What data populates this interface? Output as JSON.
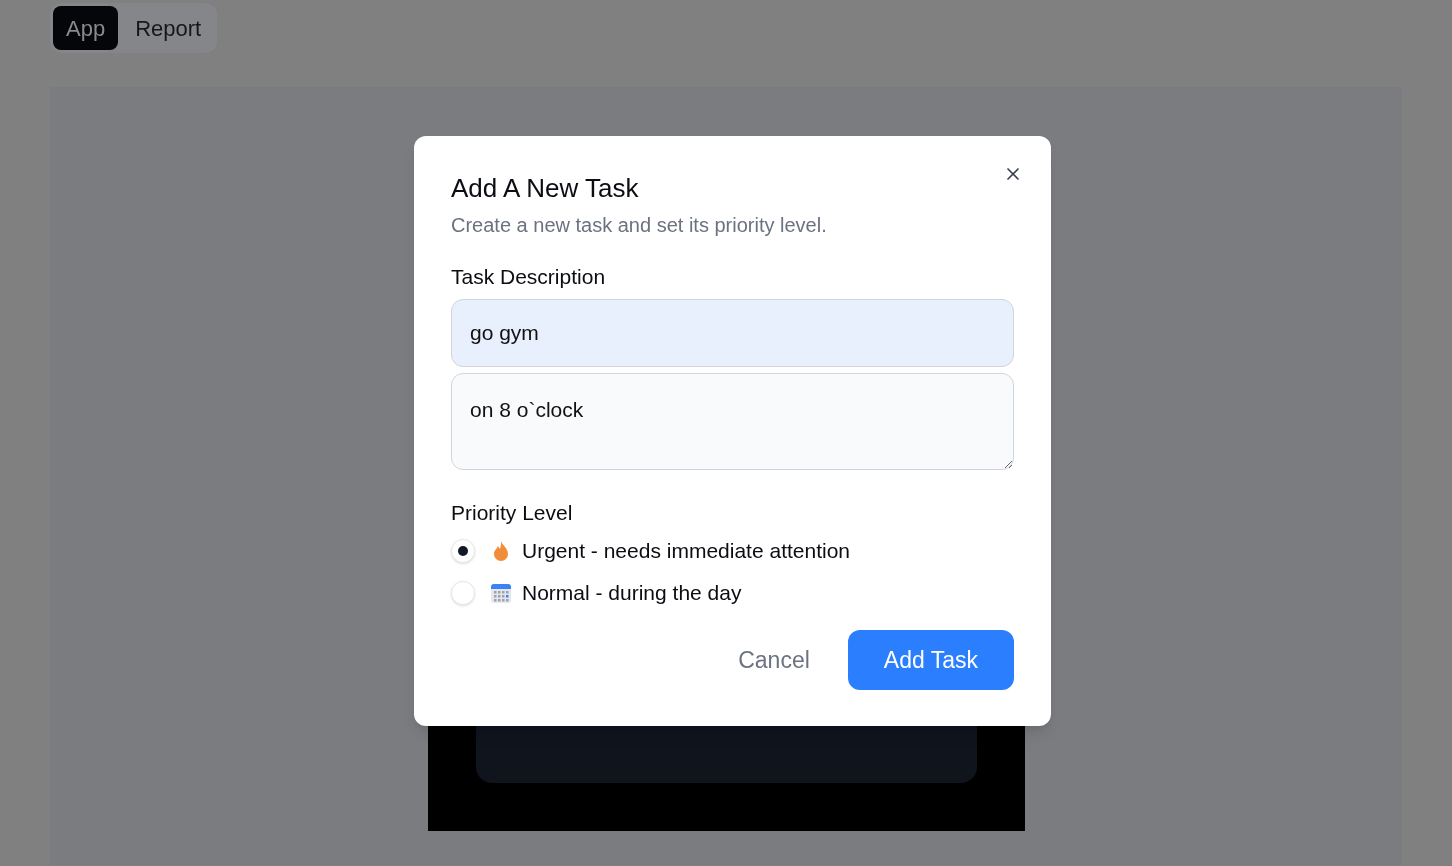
{
  "nav_tabs": [
    {
      "label": "App",
      "selected": true
    },
    {
      "label": "Report",
      "selected": false
    }
  ],
  "dialog": {
    "title": "Add A New Task",
    "subtitle": "Create a new task and set its priority level.",
    "field_label": "Task Description",
    "title_value": "go gym",
    "details_value": "on 8 o`clock",
    "priority_label": "Priority Level",
    "priorities": [
      {
        "kind": "fire",
        "label": "Urgent - needs immediate attention",
        "selected": true
      },
      {
        "kind": "calendar",
        "label": "Normal - during the day",
        "selected": false
      }
    ],
    "buttons": [
      {
        "kind": "secondary",
        "label": "Cancel"
      },
      {
        "kind": "primary",
        "label": "Add Task"
      }
    ]
  }
}
